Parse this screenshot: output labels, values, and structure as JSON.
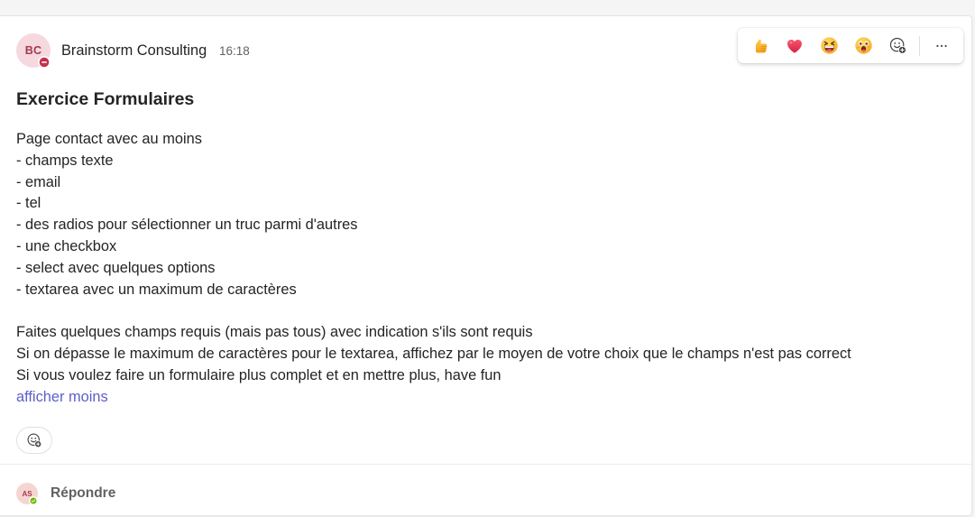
{
  "post": {
    "author": {
      "initials": "BC",
      "name": "Brainstorm Consulting",
      "status_icon": "do-not-disturb-icon"
    },
    "timestamp": "16:18",
    "title": "Exercice Formulaires",
    "intro": "Page contact avec au moins",
    "requirements": [
      "- champs texte",
      "- email",
      "- tel",
      "- des radios pour sélectionner un truc parmi d'autres",
      "- une checkbox",
      "- select avec quelques options",
      "- textarea avec un maximum de caractères"
    ],
    "notes": [
      "Faites quelques champs requis (mais pas tous) avec indication s'ils sont requis",
      "Si on dépasse le maximum de caractères pour le textarea, affichez par le moyen de votre choix que le champs n'est pas correct",
      "Si vous voulez faire un formulaire plus complet et en mettre plus, have fun"
    ],
    "show_less_label": "afficher moins",
    "add_reaction_icon": "add-reaction-icon"
  },
  "reaction_toolbar": {
    "reactions": [
      "thumbs-up-icon",
      "heart-icon",
      "laughing-face-icon",
      "surprised-face-icon"
    ],
    "add_reaction_icon": "add-reaction-icon",
    "more_icon": "more-options-icon"
  },
  "reply": {
    "initials": "AS",
    "status_icon": "available-icon",
    "label": "Répondre"
  },
  "colors": {
    "page_bg": "#f5f5f5",
    "card_bg": "#ffffff",
    "text": "#242424",
    "secondary_text": "#616161",
    "link": "#5b5fc7",
    "avatar_bg": "#f6d8df",
    "reply_avatar_bg": "#f5d5d2",
    "avatar_text": "#a33a4f",
    "do_not_disturb": "#c4314b",
    "available": "#6bb700",
    "border": "#e5e5e5"
  }
}
